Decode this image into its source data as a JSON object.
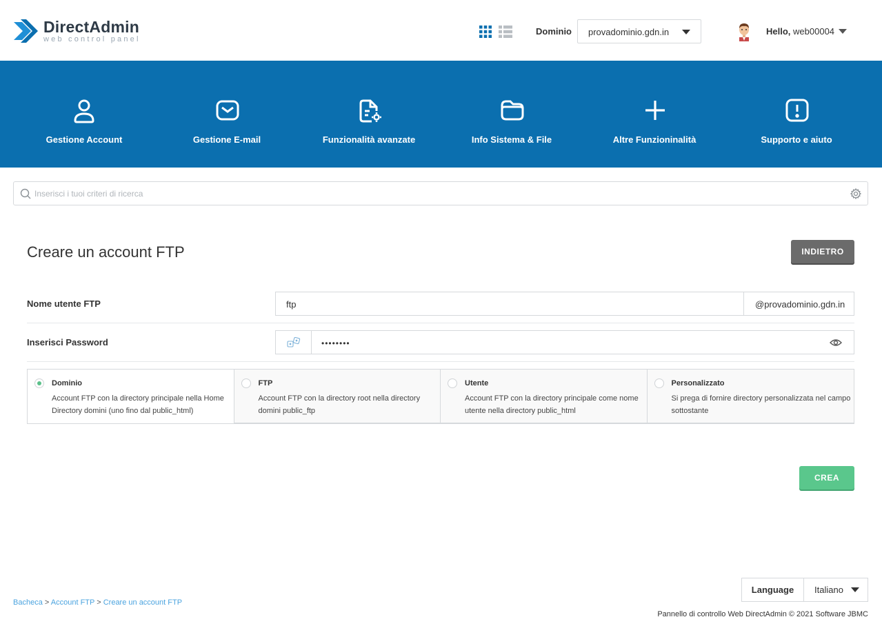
{
  "header": {
    "logo_title": "DirectAdmin",
    "logo_subtitle": "web control panel",
    "domain_label": "Dominio",
    "domain_value": "provadominio.gdn.in",
    "hello_prefix": "Hello,",
    "username": "web00004"
  },
  "nav": {
    "items": [
      {
        "label": "Gestione Account",
        "icon": "user-icon"
      },
      {
        "label": "Gestione E-mail",
        "icon": "envelope-icon"
      },
      {
        "label": "Funzionalità avanzate",
        "icon": "file-settings-icon"
      },
      {
        "label": "Info Sistema & File",
        "icon": "folder-icon"
      },
      {
        "label": "Altre Funzioninalità",
        "icon": "plus-icon"
      },
      {
        "label": "Supporto e aiuto",
        "icon": "alert-icon"
      }
    ]
  },
  "search": {
    "placeholder": "Inserisci i tuoi criteri di ricerca"
  },
  "page": {
    "title": "Creare un account FTP",
    "back_label": "INDIETRO"
  },
  "form": {
    "username_label": "Nome utente FTP",
    "username_value": "ftp",
    "username_suffix": "@provadominio.gdn.in",
    "password_label": "Inserisci Password",
    "password_value": "••••••••",
    "options": [
      {
        "title": "Dominio",
        "desc": "Account FTP con la directory principale nella Home Directory domini (uno fino dal public_html)",
        "selected": true
      },
      {
        "title": "FTP",
        "desc": "Account FTP con la directory root nella directory domini public_ftp",
        "selected": false
      },
      {
        "title": "Utente",
        "desc": "Account FTP con la directory principale come nome utente nella directory public_html",
        "selected": false
      },
      {
        "title": "Personalizzato",
        "desc": "Si prega di fornire directory personalizzata nel campo sottostante",
        "selected": false
      }
    ],
    "create_label": "CREA"
  },
  "footer": {
    "breadcrumb": [
      {
        "label": "Bacheca"
      },
      {
        "label": "Account FTP"
      },
      {
        "label": "Creare un account FTP"
      }
    ],
    "breadcrumb_sep": ">",
    "language_label": "Language",
    "language_value": "Italiano",
    "copyright": "Pannello di controllo Web DirectAdmin © 2021 Software JBMC"
  },
  "colors": {
    "nav_bg": "#0b6faf",
    "create_btn": "#5ac78c",
    "back_btn": "#6b6b6b",
    "link": "#4aa3df"
  }
}
